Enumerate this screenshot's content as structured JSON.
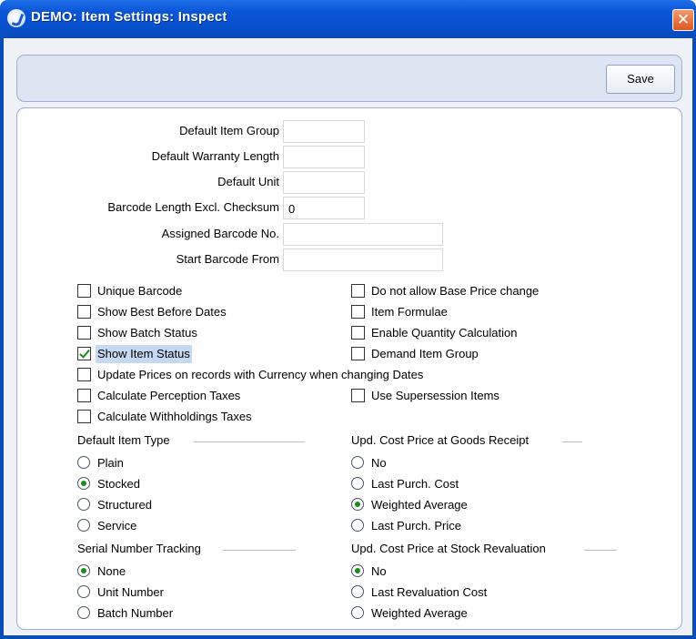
{
  "window": {
    "title": "DEMO: Item Settings: Inspect",
    "close_glyph": "✕"
  },
  "toolbar": {
    "save_label": "Save"
  },
  "fields": [
    {
      "label": "Default Item Group",
      "value": ""
    },
    {
      "label": "Default Warranty Length",
      "value": ""
    },
    {
      "label": "Default Unit",
      "value": ""
    },
    {
      "label": "Barcode Length Excl. Checksum",
      "value": "0"
    },
    {
      "label": "Assigned Barcode No.",
      "value": ""
    },
    {
      "label": "Start Barcode From",
      "value": ""
    }
  ],
  "checkboxes_left": [
    {
      "label": "Unique Barcode",
      "checked": false
    },
    {
      "label": "Show Best Before Dates",
      "checked": false
    },
    {
      "label": "Show Batch Status",
      "checked": false
    },
    {
      "label": "Show Item Status",
      "checked": true
    },
    {
      "label": "Update Prices on records with Currency when changing Dates",
      "checked": false
    },
    {
      "label": "Calculate Perception Taxes",
      "checked": false
    },
    {
      "label": "Calculate Withholdings Taxes",
      "checked": false
    }
  ],
  "checkboxes_right": [
    {
      "label": "Do not allow Base Price change",
      "checked": false
    },
    {
      "label": "Item Formulae",
      "checked": false
    },
    {
      "label": "Enable Quantity Calculation",
      "checked": false
    },
    {
      "label": "Demand Item Group",
      "checked": false
    },
    {
      "label": "Use Supersession Items",
      "checked": false
    }
  ],
  "groups": {
    "default_item_type": {
      "title": "Default Item Type",
      "options": [
        "Plain",
        "Stocked",
        "Structured",
        "Service"
      ],
      "selected": 1
    },
    "cost_goods_receipt": {
      "title": "Upd. Cost Price at Goods Receipt",
      "options": [
        "No",
        "Last Purch. Cost",
        "Weighted Average",
        "Last Purch. Price"
      ],
      "selected": 2
    },
    "serial_tracking": {
      "title": "Serial Number Tracking",
      "options": [
        "None",
        "Unit Number",
        "Batch Number"
      ],
      "selected": 0
    },
    "cost_stock_revaluation": {
      "title": "Upd. Cost Price at Stock Revaluation",
      "options": [
        "No",
        "Last Revaluation Cost",
        "Weighted Average"
      ],
      "selected": 0
    }
  },
  "colors": {
    "titlebar": "#0a56d8",
    "check_mark": "#1a8c1a",
    "highlight": "#c5d9f3"
  }
}
